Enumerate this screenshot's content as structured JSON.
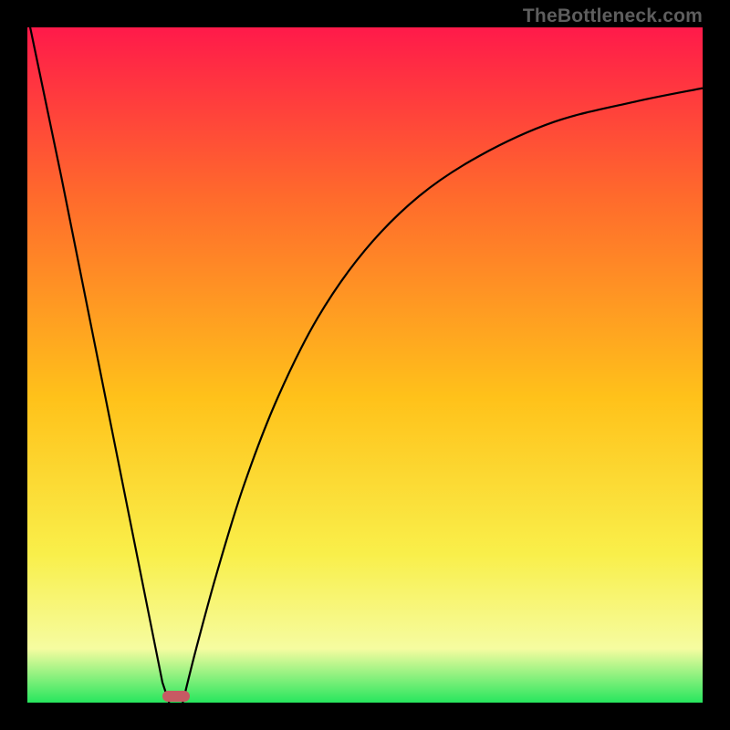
{
  "watermark": "TheBottleneck.com",
  "colors": {
    "frame": "#000000",
    "curve": "#000000",
    "marker": "#c75a63",
    "gradient_top": "#ff1a4a",
    "gradient_mid_top": "#ff6a2c",
    "gradient_mid": "#ffc21a",
    "gradient_mid_low": "#f9ef4a",
    "gradient_low": "#f6fca0",
    "gradient_bottom": "#27e65e"
  },
  "chart_data": {
    "type": "line",
    "title": "",
    "xlabel": "",
    "ylabel": "",
    "xlim": [
      0,
      100
    ],
    "ylim": [
      0,
      100
    ],
    "series": [
      {
        "name": "curve-left-branch",
        "x": [
          0,
          5,
          10,
          15,
          18,
          20,
          21
        ],
        "values": [
          102,
          78,
          53,
          28,
          13,
          3,
          0
        ]
      },
      {
        "name": "curve-right-branch",
        "x": [
          23,
          25,
          28,
          32,
          37,
          43,
          50,
          58,
          67,
          78,
          90,
          100
        ],
        "values": [
          0,
          8,
          19,
          32,
          45,
          57,
          67,
          75,
          81,
          86,
          89,
          91
        ]
      }
    ],
    "marker": {
      "x_center": 22,
      "width_pct": 4,
      "y": 0
    },
    "annotations": []
  }
}
